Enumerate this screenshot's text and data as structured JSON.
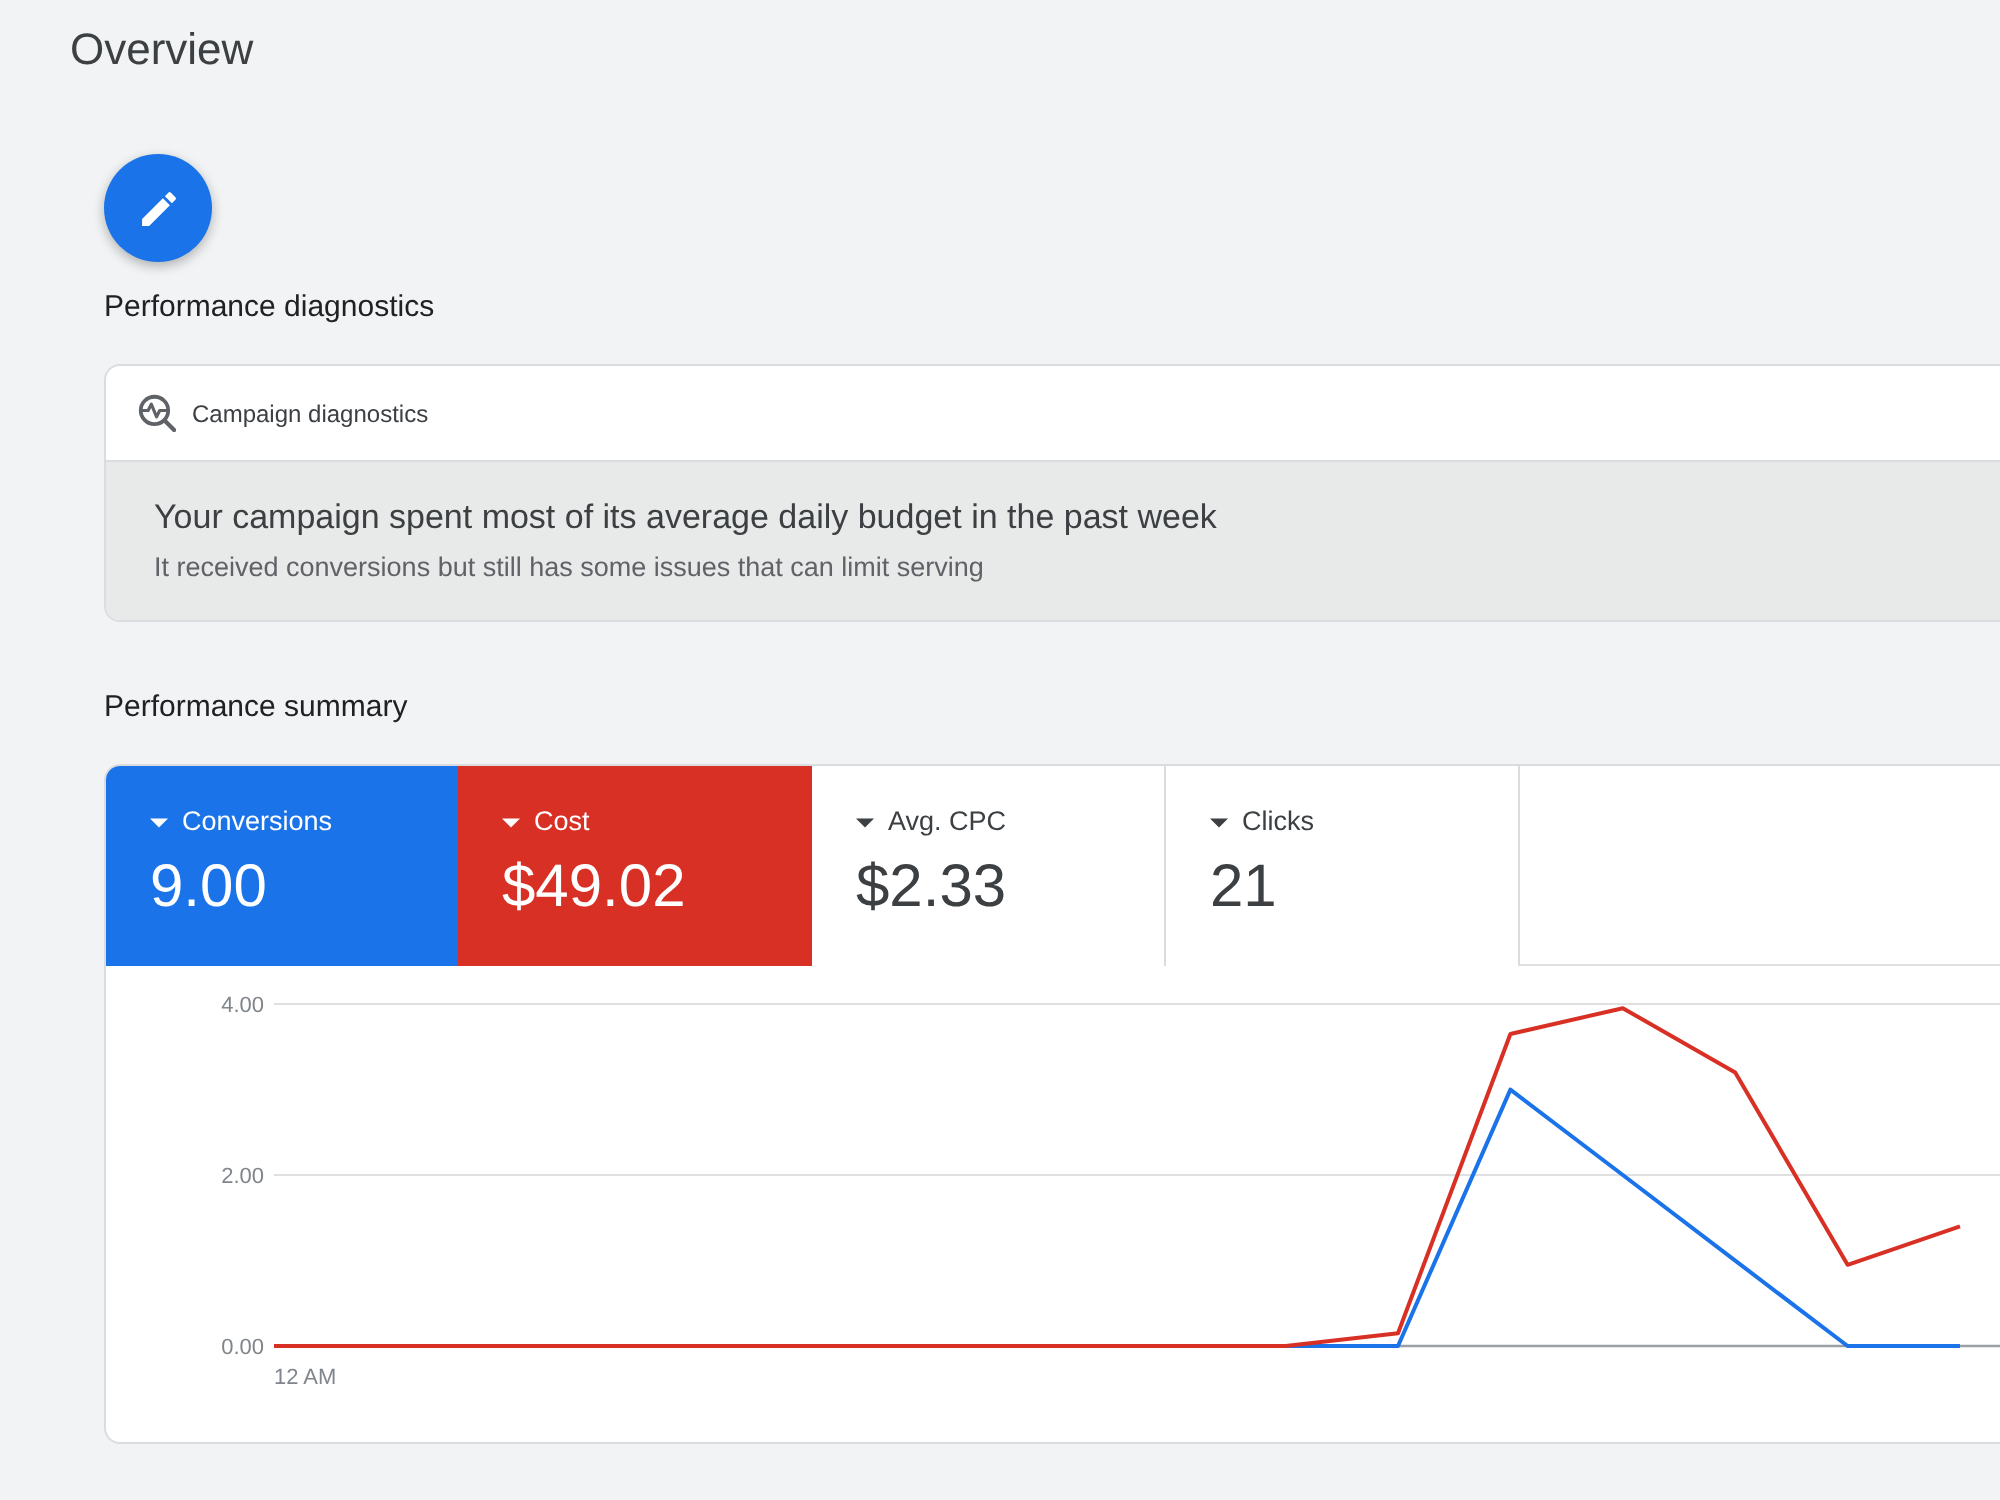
{
  "page": {
    "title": "Overview"
  },
  "diagnostics": {
    "heading": "Performance diagnostics",
    "card_title": "Campaign diagnostics",
    "message": "Your campaign spent most of its average daily budget in the past week",
    "detail": "It received conversions but still has some issues that can limit serving"
  },
  "summary": {
    "heading": "Performance summary",
    "metrics": [
      {
        "label": "Conversions",
        "value": "9.00",
        "selected": true,
        "color": "#1a73e8"
      },
      {
        "label": "Cost",
        "value": "$49.02",
        "selected": true,
        "color": "#d93025"
      },
      {
        "label": "Avg. CPC",
        "value": "$2.33",
        "selected": false
      },
      {
        "label": "Clicks",
        "value": "21",
        "selected": false
      }
    ],
    "chart_data": [
      {
        "type": "line",
        "categories": [
          "12 AM",
          null,
          null,
          null,
          null,
          null,
          null,
          null,
          null,
          null,
          null,
          null,
          null,
          null,
          null,
          null
        ],
        "series": [
          {
            "color": "#1a73e8",
            "values": [
              null,
              null,
              null,
              null,
              null,
              null,
              null,
              null,
              null,
              0,
              0,
              3,
              2,
              1,
              0,
              0
            ]
          },
          {
            "color": "#d93025",
            "values": [
              0,
              0,
              0,
              0,
              0,
              0,
              0,
              0,
              0,
              0,
              0.15,
              3.65,
              3.95,
              3.2,
              0.95,
              1.4
            ]
          }
        ],
        "ylim": [
          0,
          4
        ],
        "yticks": [
          {
            "value": 0,
            "label": "0.00"
          },
          {
            "value": 2,
            "label": "2.00"
          },
          {
            "value": 4,
            "label": "4.00"
          }
        ],
        "grid": true
      }
    ]
  }
}
